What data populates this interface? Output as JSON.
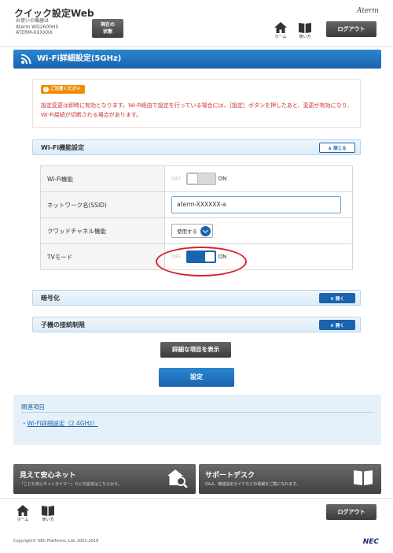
{
  "header": {
    "app_title": "クイック設定Web",
    "device_line1": "お使いの機器は",
    "device_line2": "Aterm WG2600HS",
    "device_line3": "ATERM-XXXXXX",
    "status_label_1": "現在の",
    "status_label_2": "状態",
    "brand": "Aterm",
    "nav_home": "ホーム",
    "nav_manual": "使い方",
    "logout": "ログアウト"
  },
  "page": {
    "title": "Wi-Fi詳細設定(5GHz)"
  },
  "notice": {
    "badge": "ご注意ください",
    "text": "設定変更は即時に有効となります。Wi-Fi経由で設定を行っている場合には、［設定］ボタンを押したあと、変更が有効になり、Wi-Fi接続が切断される場合があります。"
  },
  "wifi_section": {
    "title": "Wi-Fi機能設定",
    "toggle_button": "閉じる",
    "rows": [
      {
        "label": "Wi-Fi機能",
        "off": "OFF",
        "on": "ON",
        "state": "off"
      },
      {
        "label": "ネットワーク名(SSID)",
        "value": "aterm-XXXXXX-a"
      },
      {
        "label": "クワッドチャネル機能",
        "value": "使用する"
      },
      {
        "label": "TVモード",
        "off": "OFF",
        "on": "ON",
        "state": "on"
      }
    ]
  },
  "encryption_section": {
    "title": "暗号化",
    "toggle_button": "開く"
  },
  "client_section": {
    "title": "子機の接続制限",
    "toggle_button": "開く"
  },
  "buttons": {
    "show_details": "詳細な項目を表示",
    "submit": "設定"
  },
  "related": {
    "title": "関連項目",
    "link": "Wi-Fi詳細設定（2.4GHz）"
  },
  "banners": {
    "left_title": "見えて安心ネット",
    "left_sub": "「こども安心ネットタイマー」などの設定はこちらから。",
    "right_title": "サポートデスク",
    "right_sub": "Q&A、機能設定ガイドなどの情報をご覧になれます。"
  },
  "footer": {
    "nav_home": "ホーム",
    "nav_manual": "使い方",
    "logout": "ログアウト",
    "copyright": "Copyright© NEC Platforms, Ltd. 2001-2019",
    "brand": "NEC"
  },
  "colors": {
    "accent": "#1a64ad",
    "warning": "#cc3333",
    "badge": "#f08c00"
  }
}
